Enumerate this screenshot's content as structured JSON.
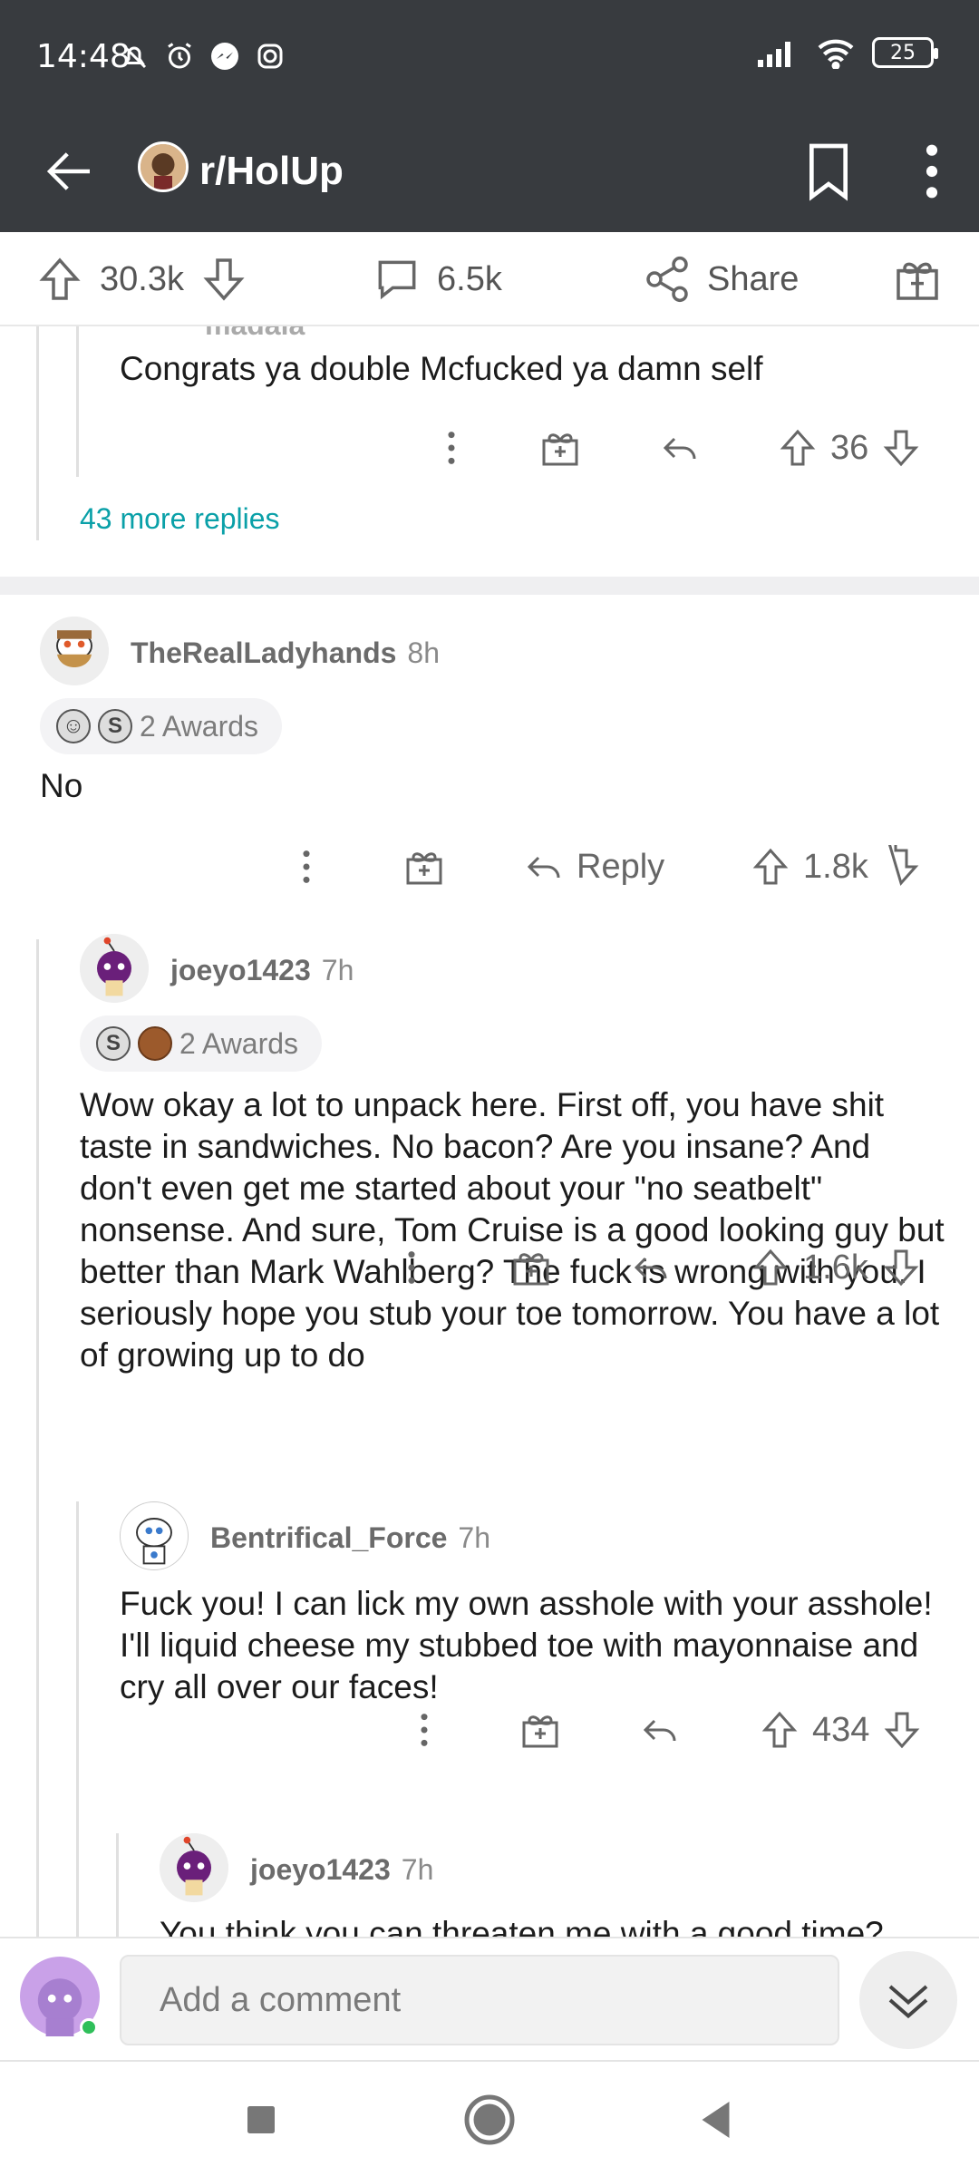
{
  "status_bar": {
    "time": "14:48",
    "battery": "25"
  },
  "app_bar": {
    "subreddit": "r/HolUp"
  },
  "post_actions": {
    "upvotes": "30.3k",
    "comments": "6.5k",
    "share": "Share"
  },
  "prev_comment": {
    "username_partial": "madala",
    "text": "Congrats ya double Mcfucked ya damn self",
    "score": "36",
    "more_replies": "43 more replies"
  },
  "comments": [
    {
      "username": "TheRealLadyhands",
      "time": "8h",
      "awards": "2 Awards",
      "text": "No",
      "reply_label": "Reply",
      "score": "1.8k"
    },
    {
      "username": "joeyo1423",
      "time": "7h",
      "awards": "2 Awards",
      "text": "Wow okay a lot to unpack here. First off, you have shit taste in sandwiches. No bacon? Are you insane? And don't even get me started about your \"no seatbelt\" nonsense. And sure, Tom Cruise is a good looking guy but better than Mark Wahlberg? The fuck is wrong with you. I seriously hope you stub your toe tomorrow. You have a lot of growing up to do",
      "score": "1.6k"
    },
    {
      "username": "Bentrifical_Force",
      "time": "7h",
      "text": "Fuck you! I can lick my own asshole with your asshole! I'll liquid cheese my stubbed toe with mayonnaise and cry all over our faces!",
      "score": "434"
    },
    {
      "username": "joeyo1423",
      "time": "7h",
      "text": "You think you can threaten me with a good time?"
    }
  ],
  "comment_bar": {
    "placeholder": "Add a comment"
  }
}
